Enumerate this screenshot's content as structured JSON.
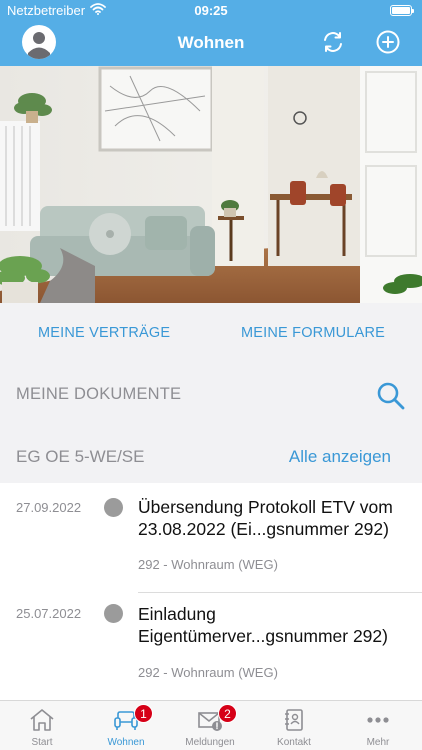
{
  "status_bar": {
    "carrier": "Netzbetreiber",
    "time": "09:25"
  },
  "nav": {
    "title": "Wohnen",
    "left_icon": "user-avatar-icon",
    "right_icons": [
      "sync-icon",
      "plus-circle-icon"
    ]
  },
  "links": {
    "contracts": "MEINE VERTRÄGE",
    "forms": "MEINE FORMULARE"
  },
  "documents": {
    "label": "MEINE DOKUMENTE",
    "search_icon": "search-icon"
  },
  "section": {
    "title": "EG OE 5-WE/SE",
    "show_all": "Alle anzeigen"
  },
  "items": [
    {
      "date": "27.09.2022",
      "title_line1": "Übersendung Protokoll ETV vom",
      "title_line2": "23.08.2022 (Ei...gsnummer 292)",
      "subtitle": "292 - Wohnraum (WEG)"
    },
    {
      "date": "25.07.2022",
      "title_line1": "Einladung",
      "title_line2": "Eigentümerver...gsnummer 292)",
      "subtitle": "292 - Wohnraum (WEG)"
    }
  ],
  "tabs": [
    {
      "label": "Start",
      "icon": "home-icon",
      "badge": ""
    },
    {
      "label": "Wohnen",
      "icon": "sofa-icon",
      "badge": "1"
    },
    {
      "label": "Meldungen",
      "icon": "mail-alert-icon",
      "badge": "2"
    },
    {
      "label": "Kontakt",
      "icon": "contact-book-icon",
      "badge": ""
    },
    {
      "label": "Mehr",
      "icon": "more-icon",
      "badge": ""
    }
  ],
  "colors": {
    "accent": "#55aee6",
    "link": "#3a98d6",
    "badge": "#d60017",
    "background": "#f2f2f4"
  }
}
